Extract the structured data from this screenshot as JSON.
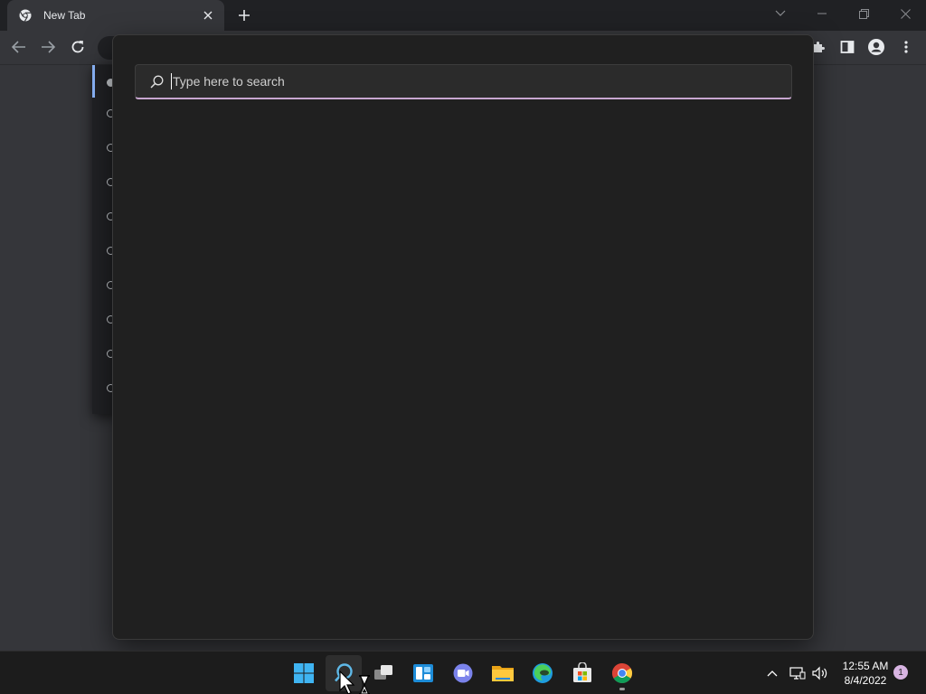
{
  "browser": {
    "tab_title": "New Tab",
    "tab_favicon": "chrome-icon"
  },
  "search": {
    "placeholder": "Type here to search",
    "value": ""
  },
  "taskbar": {
    "apps": [
      "start-icon",
      "search-icon",
      "task-view-icon",
      "widgets-icon",
      "chat-icon",
      "file-explorer-icon",
      "edge-icon",
      "store-icon",
      "chrome-icon"
    ],
    "clock_time": "12:55 AM",
    "clock_date": "8/4/2022",
    "notification_count": "1"
  },
  "colors": {
    "chrome_frame": "#202124",
    "chrome_toolbar": "#35363a",
    "search_panel": "#202020",
    "search_accent": "#c7a6cf",
    "taskbar": "#1c1c1c"
  }
}
